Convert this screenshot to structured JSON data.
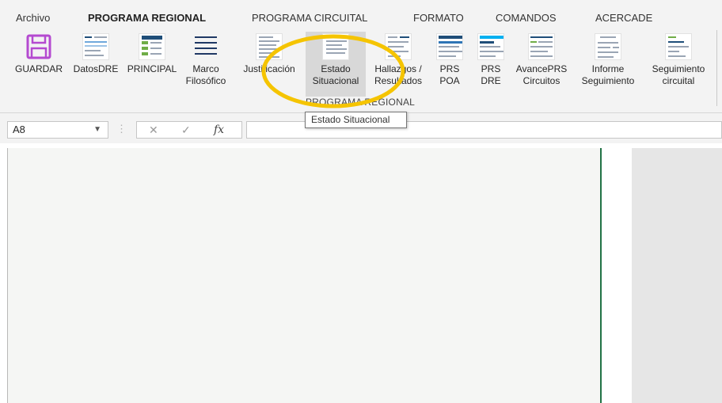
{
  "tabs": [
    {
      "label": "Archivo"
    },
    {
      "label": "PROGRAMA REGIONAL",
      "active": true
    },
    {
      "label": "PROGRAMA CIRCUITAL"
    },
    {
      "label": "FORMATO"
    },
    {
      "label": "COMANDOS"
    },
    {
      "label": "ACERCADE"
    }
  ],
  "ribbon": {
    "buttons": [
      {
        "label": "GUARDAR",
        "icon": "floppy-disk-icon"
      },
      {
        "label": "DatosDRE",
        "icon": "sheet-thumbnail-icon"
      },
      {
        "label": "PRINCIPAL",
        "icon": "sheet-thumbnail-icon"
      },
      {
        "label": "Marco\nFilosófico",
        "icon": "lines-icon"
      },
      {
        "label": "Justificación",
        "icon": "sheet-thumbnail-icon"
      },
      {
        "label": "Estado\nSituacional",
        "icon": "sheet-thumbnail-icon",
        "highlighted": true
      },
      {
        "label": "Hallazgos /\nResultados",
        "icon": "sheet-thumbnail-icon"
      },
      {
        "label": "PRS\nPOA",
        "icon": "sheet-thumbnail-icon"
      },
      {
        "label": "PRS\nDRE",
        "icon": "sheet-thumbnail-icon"
      },
      {
        "label": "AvancePRS\nCircuitos",
        "icon": "sheet-thumbnail-icon"
      },
      {
        "label": "Informe\nSeguimiento",
        "icon": "sheet-thumbnail-icon"
      },
      {
        "label": "Seguimiento\ncircuital",
        "icon": "sheet-thumbnail-icon"
      }
    ],
    "group_label": "PROGRAMA REGIONAL"
  },
  "formula_bar": {
    "name_box": "A8",
    "formula": ""
  },
  "tooltip": "Estado Situacional",
  "colors": {
    "accent": "#217346",
    "annotation": "#f5c400",
    "floppy": "#b44ad0"
  }
}
